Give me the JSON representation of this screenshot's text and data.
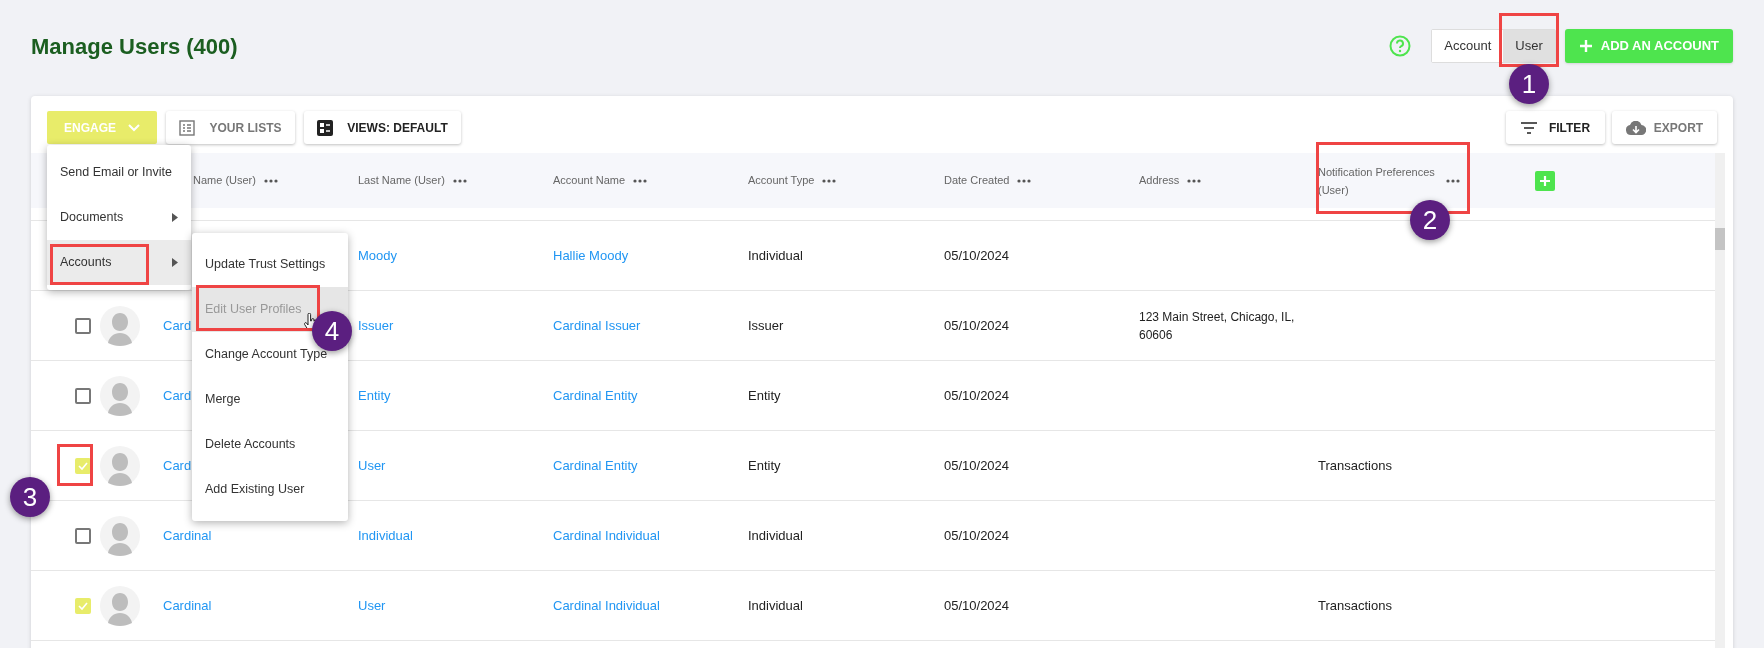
{
  "page_title": "Manage Users (400)",
  "view_toggle": [
    {
      "label": "Account",
      "selected": false
    },
    {
      "label": "User",
      "selected": true
    }
  ],
  "add_button": "ADD AN ACCOUNT",
  "toolbar": {
    "engage": "ENGAGE",
    "your_lists": "YOUR LISTS",
    "views": "VIEWS: DEFAULT",
    "filter": "FILTER",
    "export": "EXPORT"
  },
  "columns": [
    "Name (User)",
    "Last Name (User)",
    "Account Name",
    "Account Type",
    "Date Created",
    "Address",
    "Notification Preferences (User)"
  ],
  "rows": [
    {
      "last_name": "Moody",
      "account_name": "Hallie Moody",
      "account_type": "Individual",
      "date_created": "05/10/2024"
    },
    {
      "checked": false,
      "first_name": "Card",
      "last_name": "Issuer",
      "account_name": "Cardinal Issuer",
      "account_type": "Issuer",
      "date_created": "05/10/2024",
      "address": "123 Main Street, Chicago, IL, 60606"
    },
    {
      "checked": false,
      "first_name": "Card",
      "last_name": "Entity",
      "account_name": "Cardinal Entity",
      "account_type": "Entity",
      "date_created": "05/10/2024"
    },
    {
      "checked": true,
      "first_name": "Card",
      "last_name": "User",
      "account_name": "Cardinal Entity",
      "account_type": "Entity",
      "date_created": "05/10/2024",
      "notification": "Transactions"
    },
    {
      "checked": false,
      "first_name": "Cardinal",
      "last_name": "Individual",
      "account_name": "Cardinal Individual",
      "account_type": "Individual",
      "date_created": "05/10/2024"
    },
    {
      "checked": true,
      "first_name": "Cardinal",
      "last_name": "User",
      "account_name": "Cardinal Individual",
      "account_type": "Individual",
      "date_created": "05/10/2024",
      "notification": "Transactions"
    }
  ],
  "engage_menu": [
    {
      "label": "Send Email or Invite",
      "submenu": false,
      "highlighted": false
    },
    {
      "label": "Documents",
      "submenu": true,
      "highlighted": false
    },
    {
      "label": "Accounts",
      "submenu": true,
      "highlighted": true
    }
  ],
  "accounts_submenu": [
    {
      "label": "Update Trust Settings",
      "highlighted": false,
      "disabled": false
    },
    {
      "label": "Edit User Profiles",
      "highlighted": true,
      "disabled": true
    },
    {
      "label": "Change Account Type",
      "highlighted": false,
      "disabled": false
    },
    {
      "label": "Merge",
      "highlighted": false,
      "disabled": false
    },
    {
      "label": "Delete Accounts",
      "highlighted": false,
      "disabled": false
    },
    {
      "label": "Add Existing User",
      "highlighted": false,
      "disabled": false
    }
  ],
  "callouts": [
    {
      "label": "1"
    },
    {
      "label": "2"
    },
    {
      "label": "3"
    },
    {
      "label": "4"
    }
  ]
}
